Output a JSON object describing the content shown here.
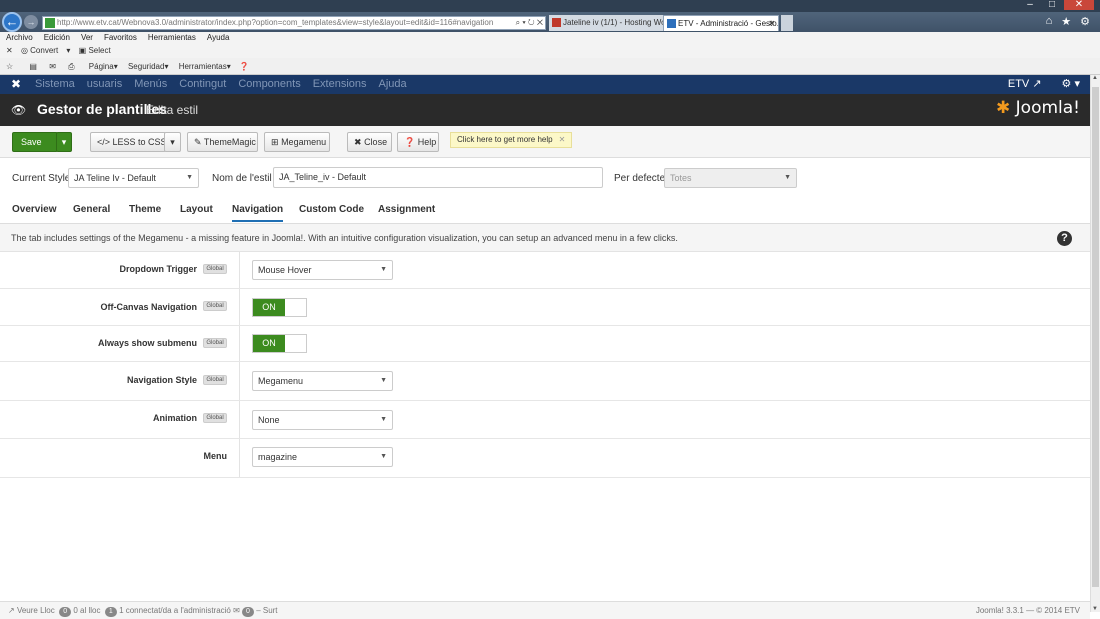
{
  "browser": {
    "address": "http://www.etv.cat/Webnova3.0/administrator/index.php?option=com_templates&view=style&layout=edit&id=116#navigation",
    "tabs": [
      {
        "title": "Jateline iv (1/1) - Hosting Wor...",
        "active": false
      },
      {
        "title": "ETV - Administració - Gesto...",
        "active": true
      }
    ],
    "menubar": [
      "Archivo",
      "Edición",
      "Ver",
      "Favoritos",
      "Herramientas",
      "Ayuda"
    ],
    "convert": "Convert",
    "select": "Select",
    "favbar": {
      "pagina": "Página",
      "seguridad": "Seguridad",
      "herramientas": "Herramientas"
    }
  },
  "joomla": {
    "nav": [
      "Sistema",
      "usuaris",
      "Menús",
      "Contingut",
      "Components",
      "Extensions",
      "Ajuda"
    ],
    "user": "ETV",
    "title": "Gestor de plantilles",
    "subtitle": "Edita estil",
    "logo": "Joomla!"
  },
  "toolbar": {
    "save": "Save",
    "less": "LESS to CSS",
    "thememagic": "ThemeMagic",
    "megamenu": "Megamenu",
    "close": "Close",
    "help": "Help",
    "tip": "Click here to get more help"
  },
  "style": {
    "current_label": "Current Style",
    "current_value": "JA Teline Iv - Default",
    "name_label": "Nom de l'estil *",
    "name_value": "JA_Teline_iv - Default",
    "default_label": "Per defecte",
    "default_value": "Totes"
  },
  "tabs": [
    "Overview",
    "General",
    "Theme",
    "Layout",
    "Navigation",
    "Custom Code",
    "Assignment"
  ],
  "active_tab": "Navigation",
  "description": "The tab includes settings of the Megamenu - a missing feature in Joomla!. With an intuitive configuration visualization, you can setup an advanced menu in a few clicks.",
  "global_badge": "Global",
  "settings": {
    "dropdown_trigger": {
      "label": "Dropdown Trigger",
      "value": "Mouse Hover"
    },
    "offcanvas": {
      "label": "Off-Canvas Navigation",
      "value": "ON"
    },
    "always_submenu": {
      "label": "Always show submenu",
      "value": "ON"
    },
    "nav_style": {
      "label": "Navigation Style",
      "value": "Megamenu"
    },
    "animation": {
      "label": "Animation",
      "value": "None"
    },
    "menu": {
      "label": "Menu",
      "value": "magazine"
    }
  },
  "status": {
    "view_site": "Veure Lloc",
    "online_count": "0",
    "online_text": "0 al lloc",
    "admin_count": "1",
    "admin_text": "1 connectat/da a l'administració",
    "msg_count": "0",
    "logout": "Surt",
    "footer": "Joomla! 3.3.1 — © 2014 ETV"
  }
}
